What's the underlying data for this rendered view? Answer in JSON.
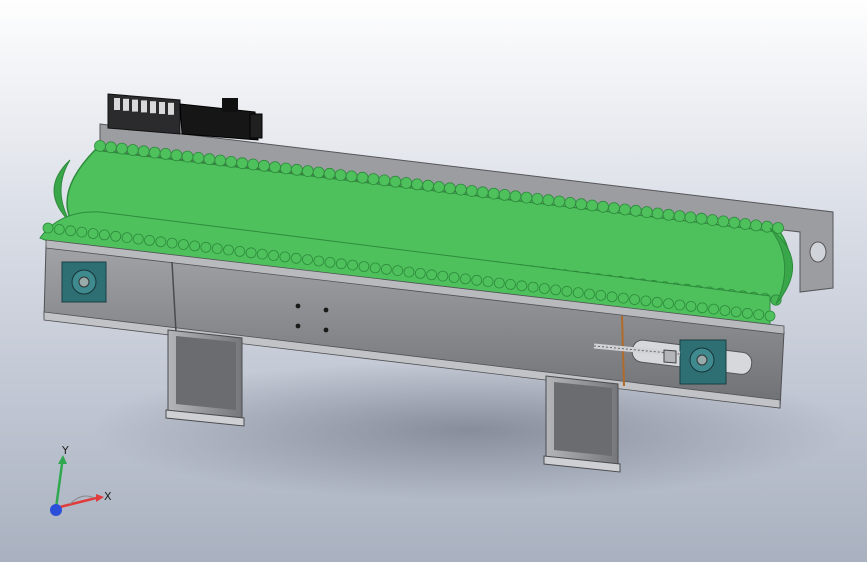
{
  "axis_triad": {
    "x_label": "X",
    "y_label": "Y",
    "x_color": "#e23b3b",
    "y_color": "#2fa84f",
    "z_color": "#2b4fd8"
  },
  "colors": {
    "belt": "#4ec15c",
    "belt_dark": "#2d8b3b",
    "frame": "#8e8f93",
    "frame_dark": "#5b5c60",
    "leg": "#9a9b9f",
    "motor": "#1b1b1b",
    "bearing": "#2e6f74"
  },
  "belt_segment_colors": [
    "#f2e21a",
    "#c62525",
    "#1f3fd0",
    "#ffffff",
    "#1e7fd3",
    "#1e7fd3",
    "#c62525",
    "#1e7fd3",
    "#e0c040"
  ]
}
